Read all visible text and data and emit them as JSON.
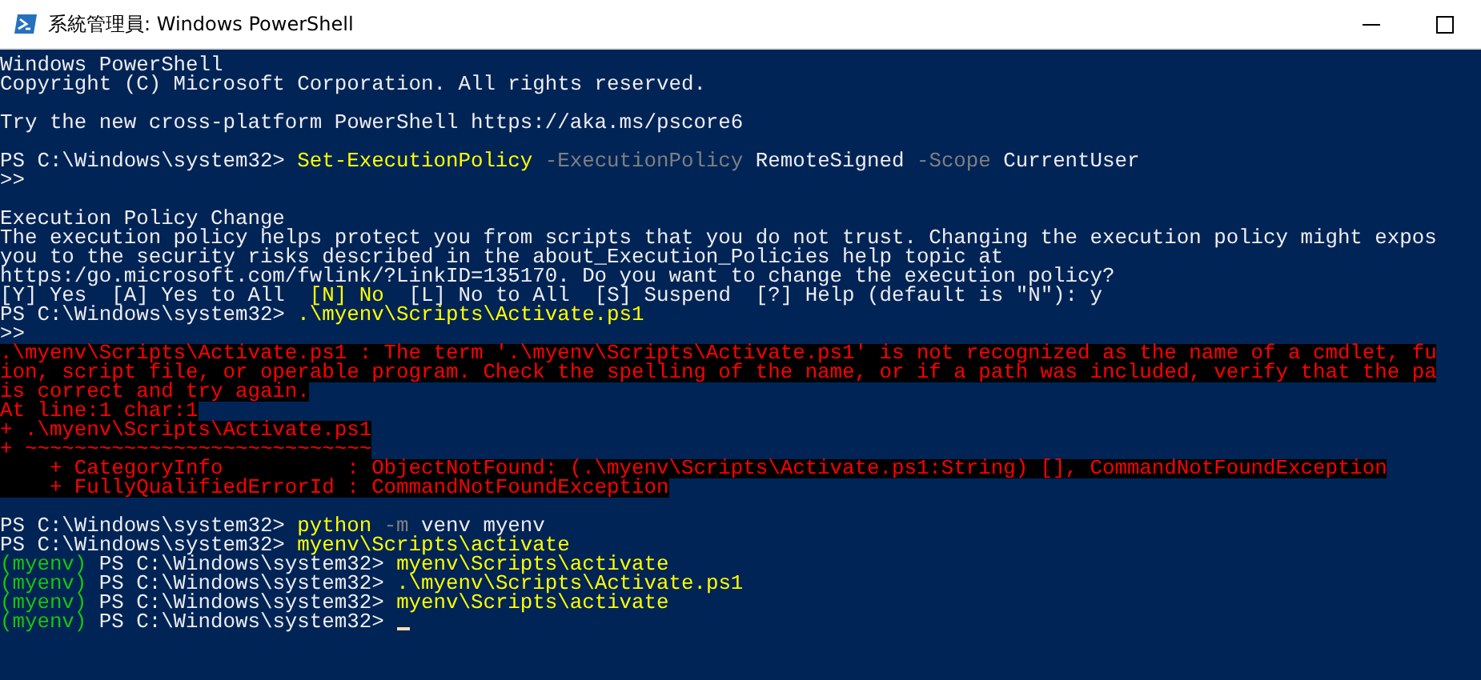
{
  "window": {
    "title": "系統管理員: Windows PowerShell"
  },
  "console": {
    "lines": [
      {
        "kind": "text",
        "segments": [
          {
            "kind": "plain",
            "text": "Windows PowerShell"
          }
        ]
      },
      {
        "kind": "text",
        "segments": [
          {
            "kind": "plain",
            "text": "Copyright (C) Microsoft Corporation. All rights reserved."
          }
        ]
      },
      {
        "kind": "blank"
      },
      {
        "kind": "text",
        "segments": [
          {
            "kind": "plain",
            "text": "Try the new cross-platform PowerShell https://aka.ms/pscore6"
          }
        ]
      },
      {
        "kind": "blank"
      },
      {
        "kind": "text",
        "segments": [
          {
            "kind": "plain",
            "text": "PS C:\\Windows\\system32> "
          },
          {
            "kind": "command",
            "text": "Set-ExecutionPolicy"
          },
          {
            "kind": "parameter",
            "text": " -ExecutionPolicy"
          },
          {
            "kind": "plain",
            "text": " RemoteSigned"
          },
          {
            "kind": "parameter",
            "text": " -Scope"
          },
          {
            "kind": "plain",
            "text": " CurrentUser"
          }
        ]
      },
      {
        "kind": "text",
        "segments": [
          {
            "kind": "plain",
            "text": ">>"
          }
        ]
      },
      {
        "kind": "blank"
      },
      {
        "kind": "text",
        "segments": [
          {
            "kind": "plain",
            "text": "Execution Policy Change"
          }
        ]
      },
      {
        "kind": "text",
        "segments": [
          {
            "kind": "plain",
            "text": "The execution policy helps protect you from scripts that you do not trust. Changing the execution policy might expos"
          }
        ]
      },
      {
        "kind": "text",
        "segments": [
          {
            "kind": "plain",
            "text": "you to the security risks described in the about_Execution_Policies help topic at"
          }
        ]
      },
      {
        "kind": "text",
        "segments": [
          {
            "kind": "plain",
            "text": "https:/go.microsoft.com/fwlink/?LinkID=135170. Do you want to change the execution policy?"
          }
        ]
      },
      {
        "kind": "text",
        "segments": [
          {
            "kind": "plain",
            "text": "[Y] Yes  [A] Yes to All  "
          },
          {
            "kind": "command",
            "text": "[N] No"
          },
          {
            "kind": "plain",
            "text": "  [L] No to All  [S] Suspend  [?] Help (default is \"N\"): y"
          }
        ]
      },
      {
        "kind": "text",
        "segments": [
          {
            "kind": "plain",
            "text": "PS C:\\Windows\\system32> "
          },
          {
            "kind": "command",
            "text": ".\\myenv\\Scripts\\Activate.ps1"
          }
        ]
      },
      {
        "kind": "text",
        "segments": [
          {
            "kind": "plain",
            "text": ">>"
          }
        ]
      },
      {
        "kind": "text",
        "segments": [
          {
            "kind": "error",
            "text": ".\\myenv\\Scripts\\Activate.ps1 : The term '.\\myenv\\Scripts\\Activate.ps1' is not recognized as the name of a cmdlet, fu"
          }
        ]
      },
      {
        "kind": "text",
        "segments": [
          {
            "kind": "error",
            "text": "ion, script file, or operable program. Check the spelling of the name, or if a path was included, verify that the pa"
          }
        ]
      },
      {
        "kind": "text",
        "segments": [
          {
            "kind": "error",
            "text": "is correct and try again."
          }
        ]
      },
      {
        "kind": "text",
        "segments": [
          {
            "kind": "error",
            "text": "At line:1 char:1"
          }
        ]
      },
      {
        "kind": "text",
        "segments": [
          {
            "kind": "error",
            "text": "+ .\\myenv\\Scripts\\Activate.ps1"
          }
        ]
      },
      {
        "kind": "text",
        "segments": [
          {
            "kind": "error",
            "text": "+ ~~~~~~~~~~~~~~~~~~~~~~~~~~~~"
          }
        ]
      },
      {
        "kind": "text",
        "segments": [
          {
            "kind": "error",
            "text": "    + CategoryInfo          : ObjectNotFound: (.\\myenv\\Scripts\\Activate.ps1:String) [], CommandNotFoundException"
          }
        ]
      },
      {
        "kind": "text",
        "segments": [
          {
            "kind": "error",
            "text": "    + FullyQualifiedErrorId : CommandNotFoundException"
          }
        ]
      },
      {
        "kind": "blank"
      },
      {
        "kind": "text",
        "segments": [
          {
            "kind": "plain",
            "text": "PS C:\\Windows\\system32> "
          },
          {
            "kind": "command",
            "text": "python"
          },
          {
            "kind": "parameter",
            "text": " -m"
          },
          {
            "kind": "plain",
            "text": " venv myenv"
          }
        ]
      },
      {
        "kind": "text",
        "segments": [
          {
            "kind": "plain",
            "text": "PS C:\\Windows\\system32> "
          },
          {
            "kind": "command",
            "text": "myenv\\Scripts\\activate"
          }
        ]
      },
      {
        "kind": "text",
        "segments": [
          {
            "kind": "env",
            "text": "(myenv)"
          },
          {
            "kind": "plain",
            "text": " PS C:\\Windows\\system32> "
          },
          {
            "kind": "command",
            "text": "myenv\\Scripts\\activate"
          }
        ]
      },
      {
        "kind": "text",
        "segments": [
          {
            "kind": "env",
            "text": "(myenv)"
          },
          {
            "kind": "plain",
            "text": " PS C:\\Windows\\system32> "
          },
          {
            "kind": "command",
            "text": ".\\myenv\\Scripts\\Activate.ps1"
          }
        ]
      },
      {
        "kind": "text",
        "segments": [
          {
            "kind": "env",
            "text": "(myenv)"
          },
          {
            "kind": "plain",
            "text": " PS C:\\Windows\\system32> "
          },
          {
            "kind": "command",
            "text": "myenv\\Scripts\\activate"
          }
        ]
      },
      {
        "kind": "prompt",
        "segments": [
          {
            "kind": "env",
            "text": "(myenv)"
          },
          {
            "kind": "plain",
            "text": " PS C:\\Windows\\system32> "
          }
        ]
      }
    ]
  }
}
